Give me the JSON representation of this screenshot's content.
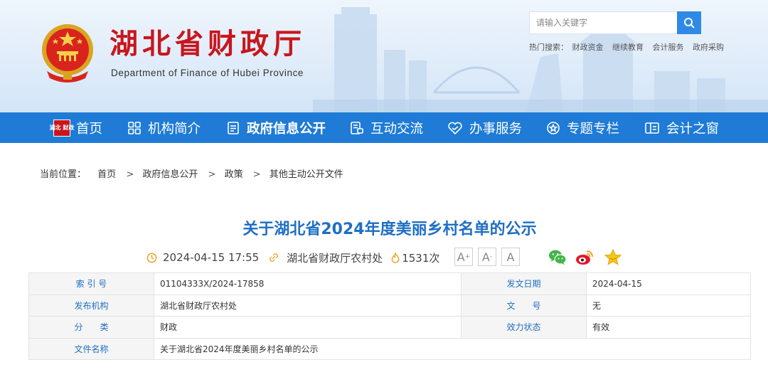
{
  "header": {
    "title": "湖北省财政厅",
    "subtitle": "Department of Finance of Hubei Province",
    "search_placeholder": "请输入关键字",
    "hot_label": "热门搜索：",
    "hot_items": [
      "财政资金",
      "继续教育",
      "会计服务",
      "政府采购"
    ]
  },
  "nav": {
    "home_logo": "湖北 财政",
    "items": [
      {
        "label": "首页",
        "icon": "home-logo"
      },
      {
        "label": "机构简介",
        "icon": "grid-icon"
      },
      {
        "label": "政府信息公开",
        "icon": "document-icon"
      },
      {
        "label": "互动交流",
        "icon": "chat-doc-icon"
      },
      {
        "label": "办事服务",
        "icon": "heart-icon"
      },
      {
        "label": "专题专栏",
        "icon": "star-circle-icon"
      },
      {
        "label": "会计之窗",
        "icon": "window-icon"
      }
    ],
    "active_index": 2
  },
  "breadcrumb": {
    "label": "当前位置：",
    "items": [
      "首页",
      "政府信息公开",
      "政策",
      "其他主动公开文件"
    ],
    "separator": ">"
  },
  "article": {
    "title": "关于湖北省2024年度美丽乡村名单的公示",
    "date": "2024-04-15 17:55",
    "source": "湖北省财政厅农村处",
    "views": "1531次",
    "font_buttons": [
      "A",
      "A",
      "A"
    ],
    "font_button_marks": [
      "+",
      "-",
      ""
    ]
  },
  "share": {
    "icons": [
      "wechat-icon",
      "weibo-icon",
      "favorite-star-icon"
    ]
  },
  "info_table": {
    "rows": [
      {
        "k1": "索 引 号",
        "v1": "01104333X/2024-17858",
        "k2": "发文日期",
        "v2": "2024-04-15"
      },
      {
        "k1": "发布机构",
        "v1": "湖北省财政厅农村处",
        "k2": "文　　号",
        "v2": "无"
      },
      {
        "k1": "分　　类",
        "v1": "财政",
        "k2": "效力状态",
        "v2": "有效"
      },
      {
        "k1": "文件名称",
        "v1": "关于湖北省2024年度美丽乡村名单的公示"
      }
    ]
  },
  "colors": {
    "brand_red": "#c8161d",
    "nav_blue": "#1f7bd6",
    "title_blue": "#1f6fc4",
    "icon_orange": "#f0a020"
  }
}
